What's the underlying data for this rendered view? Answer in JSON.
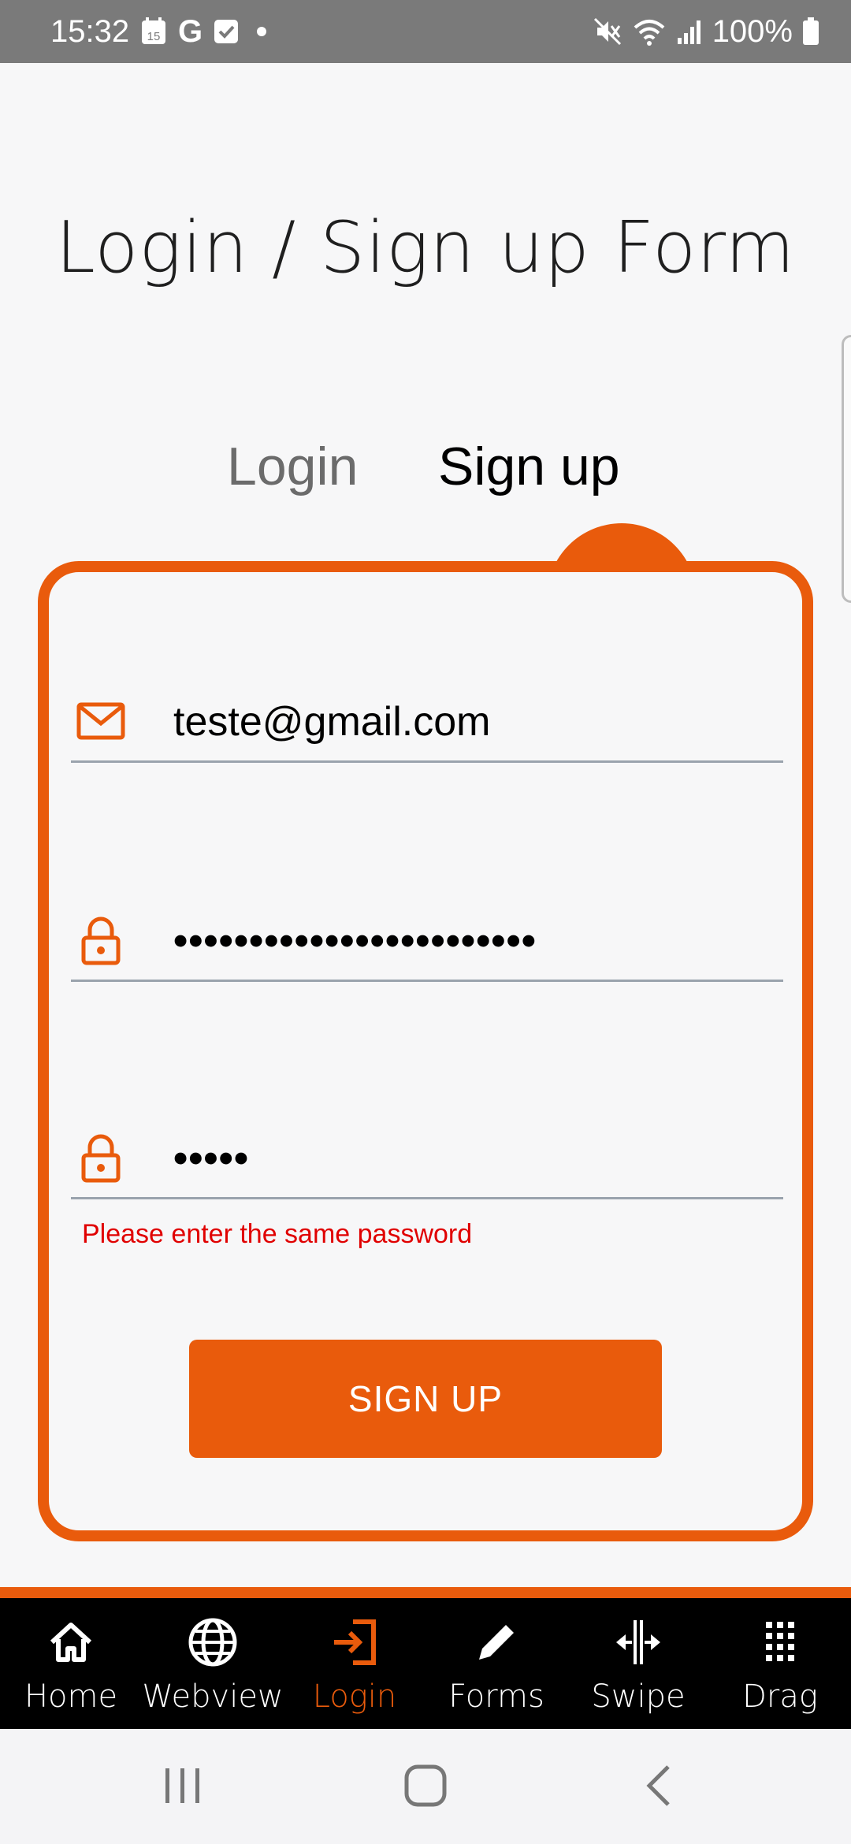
{
  "status_bar": {
    "time": "15:32",
    "calendar_day": "15",
    "google_letter": "G",
    "battery_text": "100%",
    "icons": [
      "calendar-icon",
      "google-icon",
      "task-check-icon",
      "dot-icon",
      "mute-icon",
      "wifi-icon",
      "signal-icon",
      "battery-icon"
    ]
  },
  "page": {
    "title": "Login / Sign up Form"
  },
  "tabs": [
    {
      "label": "Login",
      "active": false
    },
    {
      "label": "Sign up",
      "active": true
    }
  ],
  "form": {
    "email_value": "teste@gmail.com",
    "password_value": "••••••••••••••••••••••••",
    "confirm_password_value": "•••••",
    "error_message": "Please enter the same password",
    "submit_label": "SIGN UP"
  },
  "bottom_nav": {
    "items": [
      {
        "label": "Home",
        "icon": "home-icon",
        "active": false
      },
      {
        "label": "Webview",
        "icon": "globe-icon",
        "active": false
      },
      {
        "label": "Login",
        "icon": "login-icon",
        "active": true
      },
      {
        "label": "Forms",
        "icon": "pencil-icon",
        "active": false
      },
      {
        "label": "Swipe",
        "icon": "swipe-icon",
        "active": false
      },
      {
        "label": "Drag",
        "icon": "grid-icon",
        "active": false
      }
    ]
  },
  "colors": {
    "accent": "#e95b0c",
    "error": "#e00000",
    "status_bar": "#7a7a7a",
    "nav_background": "#000000"
  }
}
